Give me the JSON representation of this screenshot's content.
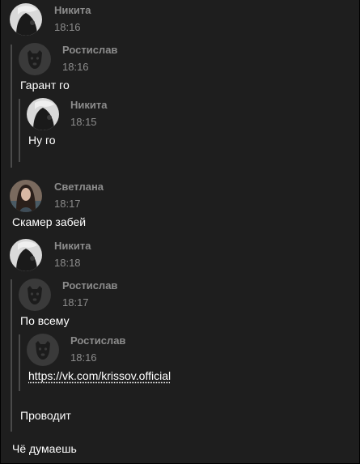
{
  "messages": {
    "m1": {
      "author": "Никита",
      "time": "18:16",
      "avatar": "avatar-nikita"
    },
    "q1": {
      "author": "Ростислав",
      "time": "18:16",
      "text": "Гарант го",
      "avatar": "avatar-default-dog"
    },
    "q1a": {
      "author": "Никита",
      "time": "18:15",
      "text": "Ну го",
      "avatar": "avatar-nikita"
    },
    "m2": {
      "author": "Светлана",
      "time": "18:17",
      "text": "Скамер забей",
      "avatar": "avatar-svetlana"
    },
    "m3": {
      "author": "Никита",
      "time": "18:18",
      "text": "Чё думаешь",
      "avatar": "avatar-nikita"
    },
    "q2": {
      "author": "Ростислав",
      "time": "18:17",
      "text": "По всему",
      "avatar": "avatar-default-dog"
    },
    "q2a": {
      "author": "Ростислав",
      "time": "18:16",
      "link": "https://vk.com/krissov.official",
      "avatar": "avatar-default-dog"
    },
    "q2_after": {
      "text": "Проводит"
    }
  },
  "colors": {
    "background": "#1e1e1e",
    "meta": "#8c8c8c",
    "text": "#ffffff",
    "quote_bar": "#4a4a4a"
  }
}
